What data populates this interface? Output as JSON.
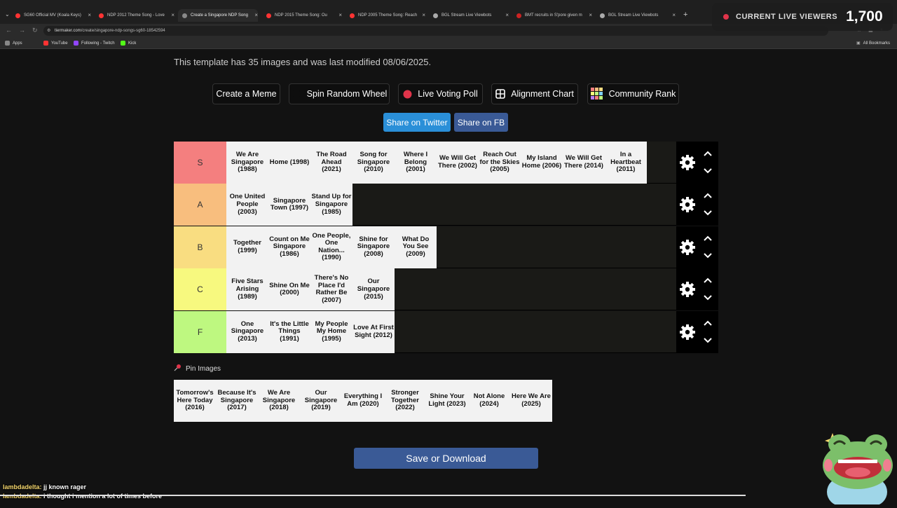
{
  "browser": {
    "tabs": [
      {
        "title": "SG60 Official MV (Koala Keys)",
        "icon_color": "#ff3333"
      },
      {
        "title": "NDP 2012 Theme Song - Love",
        "icon_color": "#ff3333"
      },
      {
        "title": "Create a Singapore NDP Song",
        "icon_color": "#888888",
        "active": true
      },
      {
        "title": "NDP 2015 Theme Song: Ou",
        "icon_color": "#ff3333"
      },
      {
        "title": "NDP 2005 Theme Song: Reach",
        "icon_color": "#ff3333"
      },
      {
        "title": "BGL Stream Live Viewbots",
        "icon_color": "#aaaaaa"
      },
      {
        "title": "BMT recruits in S'pore given m",
        "icon_color": "#cc2222"
      },
      {
        "title": "BGL Stream Live Viewbots",
        "icon_color": "#aaaaaa"
      }
    ],
    "url_host": "tiermaker.com",
    "url_path": "/create/singapore-ndp-songs-sg60-18542594",
    "bookmarks": [
      {
        "label": "Apps",
        "icon_color": "#888888"
      },
      {
        "label": "YouTube",
        "icon_color": "#ff3333"
      },
      {
        "label": "Following - Twitch",
        "icon_color": "#9146ff"
      },
      {
        "label": "Kick",
        "icon_color": "#53fc18"
      }
    ],
    "all_bookmarks": "All Bookmarks"
  },
  "overlay": {
    "viewers_label": "CURRENT LIVE VIEWERS",
    "viewers_count": "1,700"
  },
  "page": {
    "info": "This template has 35 images and was last modified 08/06/2025.",
    "buttons": {
      "meme": "Create a Meme",
      "wheel": "Spin Random Wheel",
      "poll": "Live Voting Poll",
      "alignment": "Alignment Chart",
      "community": "Community Rank"
    },
    "share_twitter": "Share on Twitter",
    "share_fb": "Share on FB",
    "share_twitter_color": "#2a8fd8",
    "share_fb_color": "#3a5a96",
    "tiers": [
      {
        "label": "S",
        "color": "#f47f7f",
        "items": [
          "We Are Singapore (1988)",
          "Home (1998)",
          "The Road Ahead (2021)",
          "Song for Singapore (2010)",
          "Where I Belong (2001)",
          "We Will Get There (2002)",
          "Reach Out for the Skies (2005)",
          "My Island Home (2006)",
          "We Will Get There (2014)",
          "In a Heartbeat (2011)"
        ]
      },
      {
        "label": "A",
        "color": "#f8be7e",
        "items": [
          "One United People (2003)",
          "Singapore Town (1997)",
          "Stand Up for Singapore (1985)"
        ]
      },
      {
        "label": "B",
        "color": "#f9dd81",
        "items": [
          "Together (1999)",
          "Count on Me Singapore (1986)",
          "One People, One Nation... (1990)",
          "Shine for Singapore (2008)",
          "What Do You See (2009)"
        ]
      },
      {
        "label": "C",
        "color": "#f7f97f",
        "items": [
          "Five Stars Arising (1989)",
          "Shine On Me (2000)",
          "There's No Place I'd Rather Be (2007)",
          "Our Singapore (2015)"
        ]
      },
      {
        "label": "F",
        "color": "#bef880",
        "items": [
          "One Singapore (2013)",
          "It's the Little Things (1991)",
          "My People My Home (1995)",
          "Love At First Sight (2012)"
        ]
      }
    ],
    "pin_label": "Pin Images",
    "pinned_items": [
      "Tomorrow's Here Today (2016)",
      "Because It's Singapore (2017)",
      "We Are Singapore (2018)",
      "Our Singapore (2019)",
      "Everything I Am (2020)",
      "Stronger Together (2022)",
      "Shine Your Light (2023)",
      "Not Alone (2024)",
      "Here We Are (2025)"
    ],
    "save": "Save or Download"
  },
  "chat": [
    {
      "user": "lambdadelta:",
      "text": "jj known rager"
    },
    {
      "user": "lambdadelta:",
      "text": "i thought i mention a lot of times before"
    }
  ]
}
